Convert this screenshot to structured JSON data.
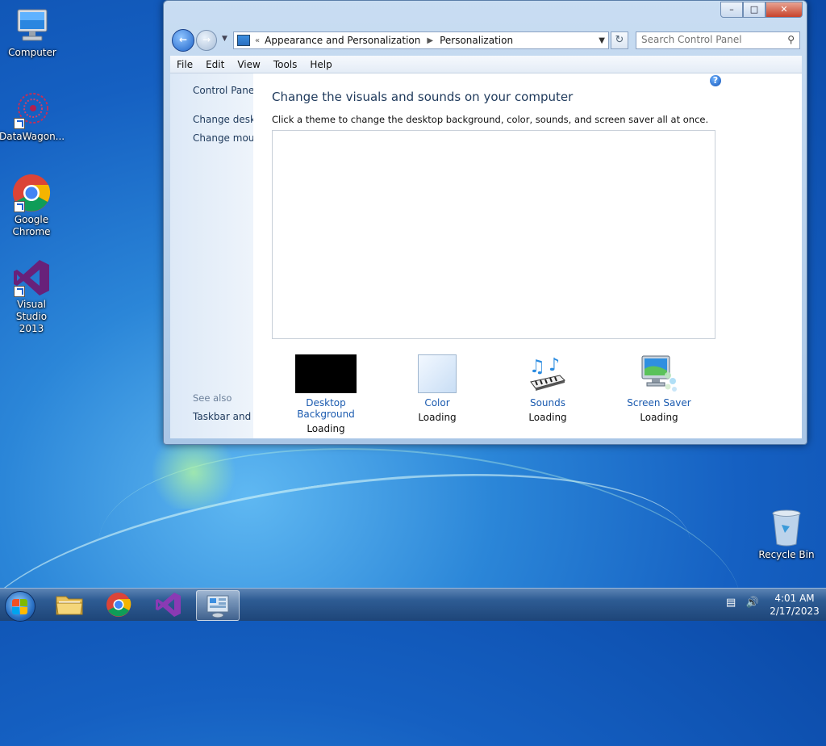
{
  "desktop": {
    "icons": [
      {
        "label": "Computer"
      },
      {
        "label": "DataWagon..."
      },
      {
        "label": "Google Chrome"
      },
      {
        "label": "Visual Studio 2013"
      },
      {
        "label": "Recycle Bin"
      }
    ]
  },
  "window": {
    "breadcrumb": [
      "Appearance and Personalization",
      "Personalization"
    ],
    "search_placeholder": "Search Control Panel",
    "menu": [
      "File",
      "Edit",
      "View",
      "Tools",
      "Help"
    ],
    "sidebar": {
      "title": "Control Panel",
      "links": [
        "Change desktop icons",
        "Change mouse pointers"
      ],
      "see_also": "See also",
      "see_also_links": [
        "Taskbar and Navigation"
      ]
    },
    "content": {
      "heading": "Change the visuals and sounds on your computer",
      "subline": "Click a theme to change the desktop background, color, sounds, and screen saver all at once.",
      "items": [
        {
          "label": "Desktop Background",
          "status": "Loading"
        },
        {
          "label": "Color",
          "status": "Loading"
        },
        {
          "label": "Sounds",
          "status": "Loading"
        },
        {
          "label": "Screen Saver",
          "status": "Loading"
        }
      ]
    }
  },
  "taskbar": {
    "time": "4:01 AM",
    "date": "2/17/2023"
  },
  "colors": {
    "accent": "#1a5aaf",
    "heading": "#1e395b"
  }
}
